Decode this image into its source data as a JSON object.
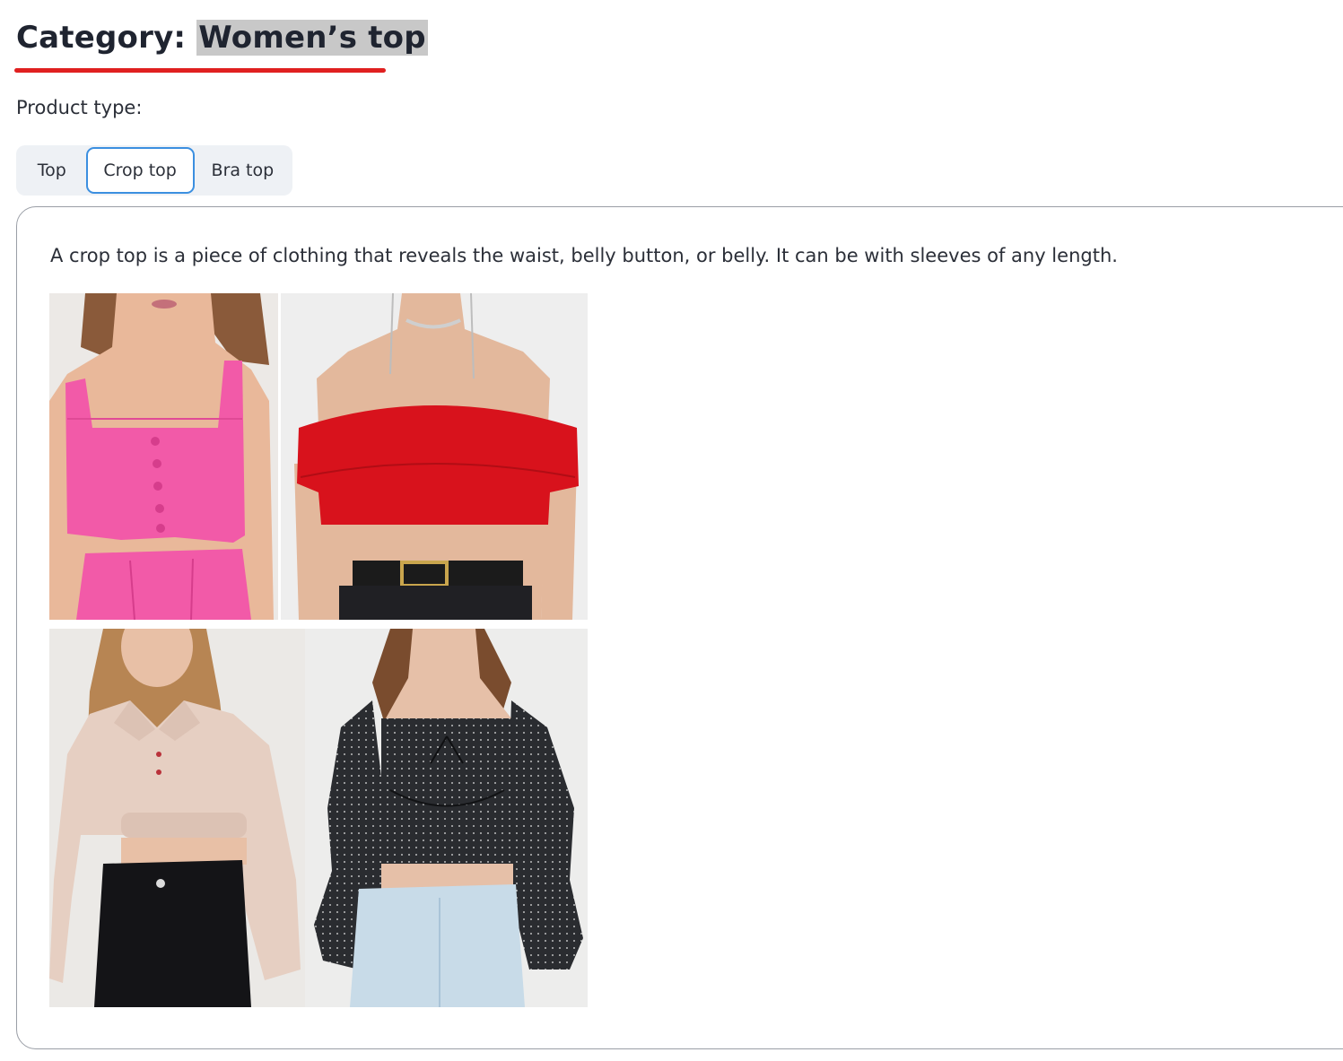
{
  "header": {
    "title_prefix": "Category: ",
    "title_value": "Women’s top",
    "underline_color": "#e02020"
  },
  "product_type": {
    "label": "Product type:",
    "tabs": [
      {
        "label": "Top",
        "selected": false
      },
      {
        "label": "Crop top",
        "selected": true
      },
      {
        "label": "Bra top",
        "selected": false
      }
    ]
  },
  "panel": {
    "description": "A crop top is a piece of clothing that reveals the waist, belly button, or belly. It can be with sleeves of any length.",
    "images": [
      {
        "name": "pink-square-neck-crop-top-photo",
        "top_color": "#f25aa8"
      },
      {
        "name": "red-off-shoulder-crop-top-photo",
        "top_color": "#d8121c"
      },
      {
        "name": "beige-polo-crop-sweatshirt-photo",
        "top_color": "#e6cfc2"
      },
      {
        "name": "black-polka-dot-puff-sleeve-crop-top-photo",
        "top_color": "#2a2c30"
      }
    ]
  }
}
